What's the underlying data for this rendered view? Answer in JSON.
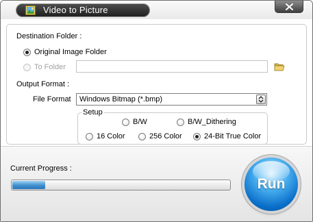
{
  "window": {
    "title": "Video to Picture",
    "close_label": "close"
  },
  "destination": {
    "heading": "Destination Folder :",
    "original_label": "Original Image Folder",
    "original_checked": true,
    "to_folder_label": "To Folder",
    "to_folder_checked": false,
    "to_folder_enabled": false,
    "to_folder_value": ""
  },
  "output": {
    "heading": "Output Format :",
    "file_format_label": "File Format",
    "file_format_value": "Windows Bitmap (*.bmp)",
    "setup": {
      "legend": "Setup",
      "options": [
        {
          "label": "B/W",
          "checked": false
        },
        {
          "label": "B/W_Dithering",
          "checked": false
        },
        {
          "label": "16 Color",
          "checked": false
        },
        {
          "label": "256 Color",
          "checked": false
        },
        {
          "label": "24-Bit True Color",
          "checked": true
        }
      ]
    }
  },
  "progress": {
    "label": "Current Progress :",
    "value": 0.15
  },
  "run_button": {
    "label": "Run"
  },
  "icons": {
    "app": "app-picture-icon",
    "close": "close-x-icon",
    "folder": "folder-open-icon",
    "dropdown": "chevron-down-icon"
  },
  "colors": {
    "run_button": "#0a6fc9",
    "progress_fill": "#3f8fce",
    "title_bar": "#1d1d1d"
  }
}
